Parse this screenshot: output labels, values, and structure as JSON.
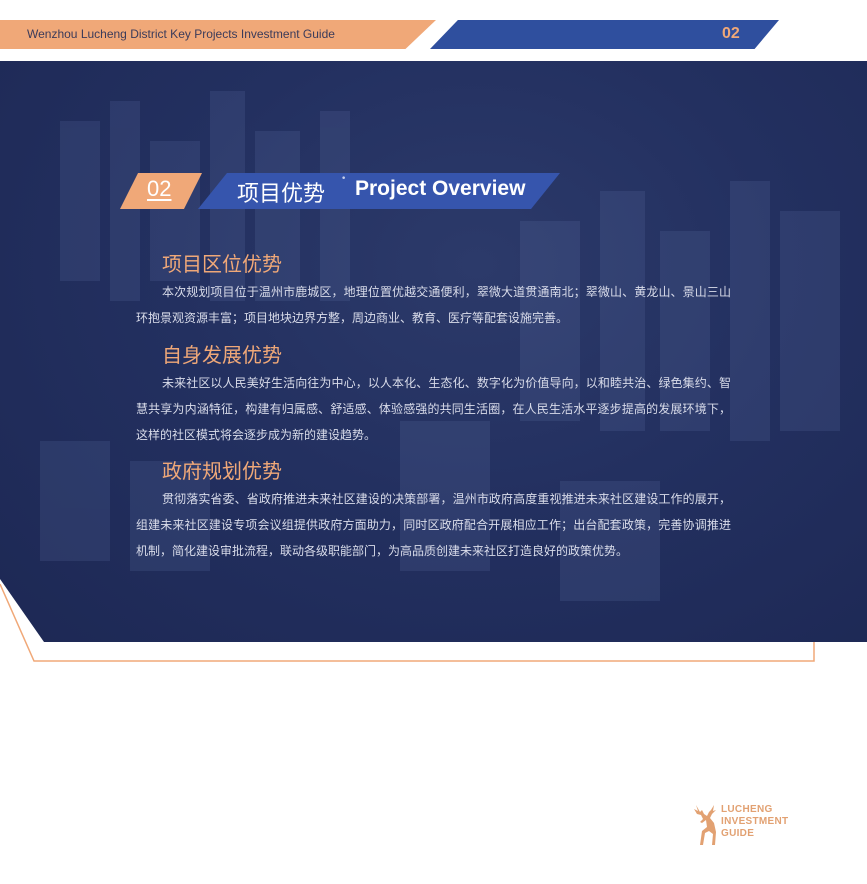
{
  "header": {
    "title": "Wenzhou Lucheng District Key Projects Investment Guide",
    "page_number": "02"
  },
  "colors": {
    "accent_orange": "#f0a878",
    "accent_blue": "#3655ad",
    "panel_navy": "#1f2b58"
  },
  "section_banner": {
    "number": "02",
    "title_cn": "项目优势",
    "title_en": "Project Overview"
  },
  "sections": [
    {
      "heading": "项目区位优势",
      "body": "本次规划项目位于温州市鹿城区，地理位置优越交通便利，翠微大道贯通南北；翠微山、黄龙山、景山三山环抱景观资源丰富；项目地块边界方整，周边商业、教育、医疗等配套设施完善。"
    },
    {
      "heading": "自身发展优势",
      "body": "未来社区以人民美好生活向往为中心，以人本化、生态化、数字化为价值导向，以和睦共治、绿色集约、智慧共享为内涵特征，构建有归属感、舒适感、体验感强的共同生活圈，在人民生活水平逐步提高的发展环境下，这样的社区模式将会逐步成为新的建设趋势。"
    },
    {
      "heading": "政府规划优势",
      "body": "贯彻落实省委、省政府推进未来社区建设的决策部署，温州市政府高度重视推进未来社区建设工作的展开，组建未来社区建设专项会议组提供政府方面助力，同时区政府配合开展相应工作；出台配套政策，完善协调推进机制，简化建设审批流程，联动各级职能部门，为高品质创建未来社区打造良好的政策优势。"
    }
  ],
  "logo": {
    "icon": "deer-icon",
    "lines": [
      "LUCHENG",
      "INVESTMENT",
      "GUIDE"
    ]
  }
}
